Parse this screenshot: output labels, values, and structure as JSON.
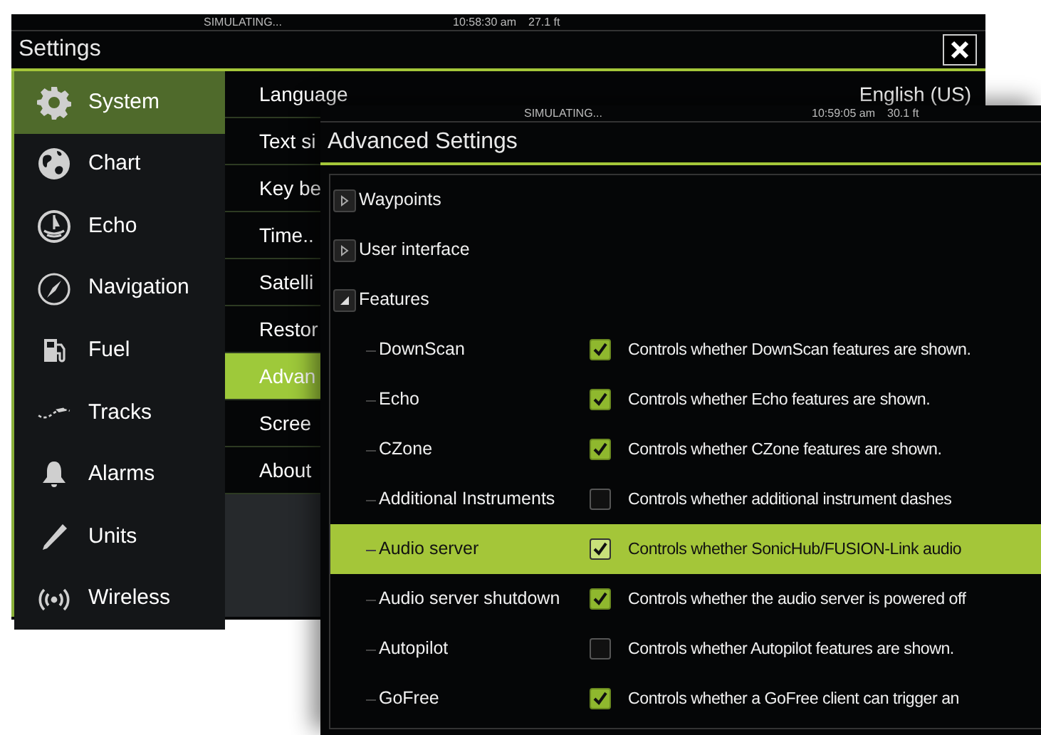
{
  "settings_window": {
    "status_bar": {
      "mode": "SIMULATING...",
      "time": "10:58:30 am",
      "depth": "27.1 ft"
    },
    "title": "Settings",
    "sidebar": [
      {
        "label": "System",
        "selected": true
      },
      {
        "label": "Chart",
        "selected": false
      },
      {
        "label": "Echo",
        "selected": false
      },
      {
        "label": "Navigation",
        "selected": false
      },
      {
        "label": "Fuel",
        "selected": false
      },
      {
        "label": "Tracks",
        "selected": false
      },
      {
        "label": "Alarms",
        "selected": false
      },
      {
        "label": "Units",
        "selected": false
      },
      {
        "label": "Wireless",
        "selected": false
      }
    ],
    "submenu": [
      {
        "label": "Language",
        "value": "English (US)",
        "selected": false
      },
      {
        "label": "Text si",
        "selected": false
      },
      {
        "label": "Key be",
        "selected": false
      },
      {
        "label": "Time..",
        "selected": false
      },
      {
        "label": "Satelli",
        "selected": false
      },
      {
        "label": "Restor",
        "selected": false
      },
      {
        "label": "Advan",
        "selected": true
      },
      {
        "label": "Scree",
        "selected": false
      },
      {
        "label": "About",
        "selected": false
      }
    ]
  },
  "advanced_window": {
    "status_bar": {
      "mode": "SIMULATING...",
      "time": "10:59:05 am",
      "depth": "30.1 ft"
    },
    "title": "Advanced Settings",
    "tree": [
      {
        "label": "Waypoints",
        "expanded": false
      },
      {
        "label": "User interface",
        "expanded": false
      },
      {
        "label": "Features",
        "expanded": true,
        "children": [
          {
            "label": "DownScan",
            "checked": true,
            "selected": false,
            "description": "Controls whether DownScan features are shown."
          },
          {
            "label": "Echo",
            "checked": true,
            "selected": false,
            "description": "Controls whether Echo features are shown."
          },
          {
            "label": "CZone",
            "checked": true,
            "selected": false,
            "description": "Controls whether CZone features are shown."
          },
          {
            "label": "Additional Instruments",
            "checked": false,
            "selected": false,
            "description": "Controls whether additional instrument dashes"
          },
          {
            "label": "Audio server",
            "checked": true,
            "selected": true,
            "description": "Controls whether SonicHub/FUSION-Link audio"
          },
          {
            "label": "Audio server shutdown",
            "checked": true,
            "selected": false,
            "description": "Controls whether the audio server is powered off"
          },
          {
            "label": "Autopilot",
            "checked": false,
            "selected": false,
            "description": "Controls whether Autopilot features are shown."
          },
          {
            "label": "GoFree",
            "checked": true,
            "selected": false,
            "description": "Controls whether a GoFree client can trigger an"
          }
        ]
      }
    ]
  }
}
